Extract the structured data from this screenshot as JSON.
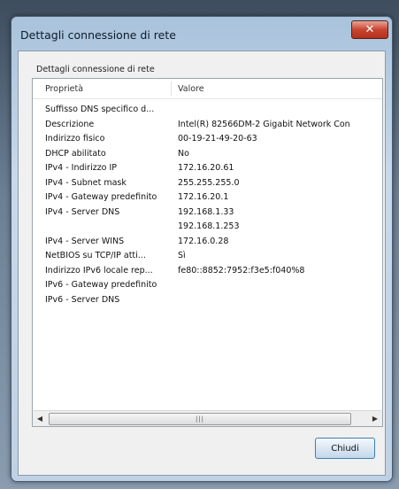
{
  "window": {
    "title": "Dettagli connessione di rete",
    "close_glyph": "✕"
  },
  "group": {
    "label": "Dettagli connessione di rete"
  },
  "table": {
    "headers": {
      "property": "Proprietà",
      "value": "Valore"
    },
    "rows": [
      {
        "property": "Suffisso DNS specifico d...",
        "value": ""
      },
      {
        "property": "Descrizione",
        "value": "Intel(R) 82566DM-2 Gigabit Network Con"
      },
      {
        "property": "Indirizzo fisico",
        "value": "00-19-21-49-20-63"
      },
      {
        "property": "DHCP abilitato",
        "value": "No"
      },
      {
        "property": "IPv4 - Indirizzo IP",
        "value": "172.16.20.61"
      },
      {
        "property": "IPv4 - Subnet mask",
        "value": "255.255.255.0"
      },
      {
        "property": "IPv4 - Gateway predefinito",
        "value": "172.16.20.1"
      },
      {
        "property": "IPv4 - Server DNS",
        "value": "192.168.1.33"
      },
      {
        "property": "",
        "value": "192.168.1.253"
      },
      {
        "property": "IPv4 - Server WINS",
        "value": "172.16.0.28"
      },
      {
        "property": "NetBIOS su TCP/IP atti...",
        "value": "Sì"
      },
      {
        "property": "Indirizzo IPv6 locale rep...",
        "value": "fe80::8852:7952:f3e5:f040%8"
      },
      {
        "property": "IPv6 - Gateway predefinito",
        "value": ""
      },
      {
        "property": "IPv6 - Server DNS",
        "value": ""
      }
    ]
  },
  "scrollbar": {
    "left_arrow": "◀",
    "right_arrow": "▶",
    "grip": "|||"
  },
  "buttons": {
    "close_label": "Chiudi"
  }
}
